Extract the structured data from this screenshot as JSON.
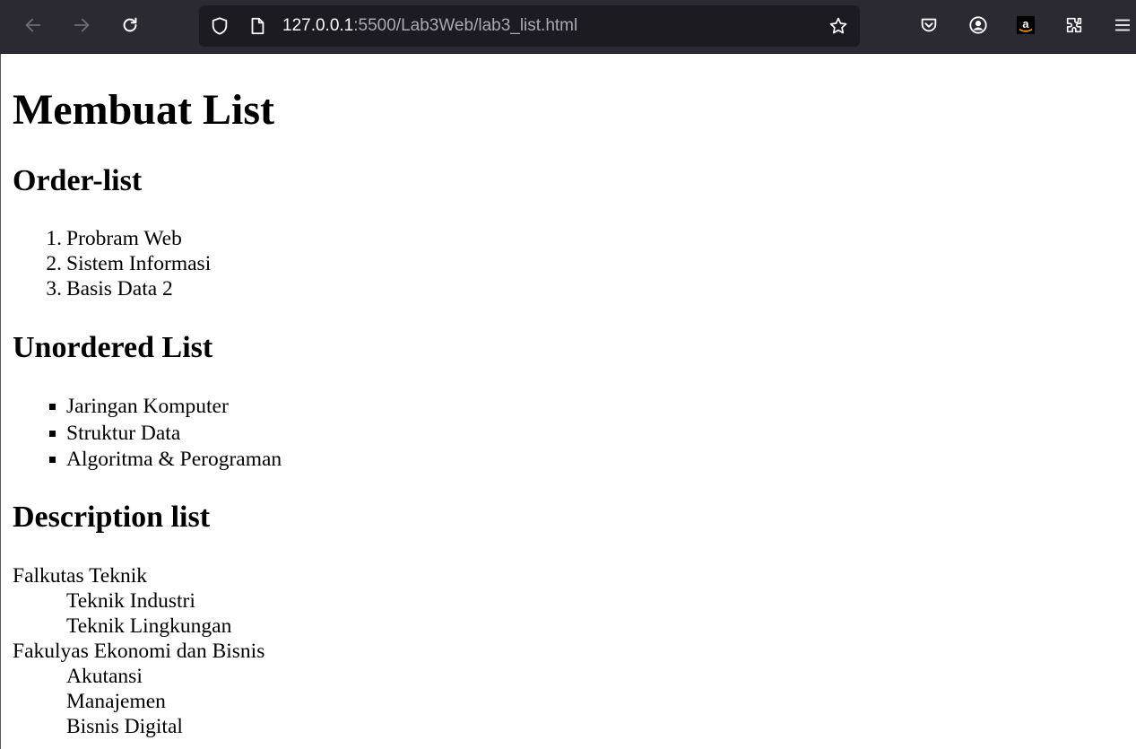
{
  "browser": {
    "url_host": "127.0.0.1",
    "url_rest": ":5500/Lab3Web/lab3_list.html",
    "icons": [
      "back-arrow-icon",
      "forward-arrow-icon",
      "reload-icon",
      "shield-icon",
      "page-icon",
      "star-icon",
      "pocket-icon",
      "account-icon",
      "amazon-icon",
      "extensions-icon",
      "menu-icon"
    ],
    "colors": {
      "toolbar": "#2b2a33",
      "urlbar": "#1c1b22",
      "text": "#fbfbfe",
      "muted": "#a9a9b3"
    }
  },
  "page": {
    "title": "Membuat List",
    "ordered": {
      "heading": "Order-list",
      "items": [
        "Probram Web",
        "Sistem Informasi",
        "Basis Data 2"
      ],
      "numbers": [
        "1.",
        "2.",
        "3."
      ]
    },
    "unordered": {
      "heading": "Unordered List",
      "items": [
        "Jaringan Komputer",
        "Struktur Data",
        "Algoritma & Perograman"
      ]
    },
    "description": {
      "heading": "Description list",
      "terms": [
        {
          "term": "Falkutas Teknik",
          "defs": [
            "Teknik Industri",
            "Teknik Lingkungan"
          ]
        },
        {
          "term": "Fakulyas Ekonomi dan Bisnis",
          "defs": [
            "Akutansi",
            "Manajemen",
            "Bisnis Digital"
          ]
        }
      ]
    }
  }
}
